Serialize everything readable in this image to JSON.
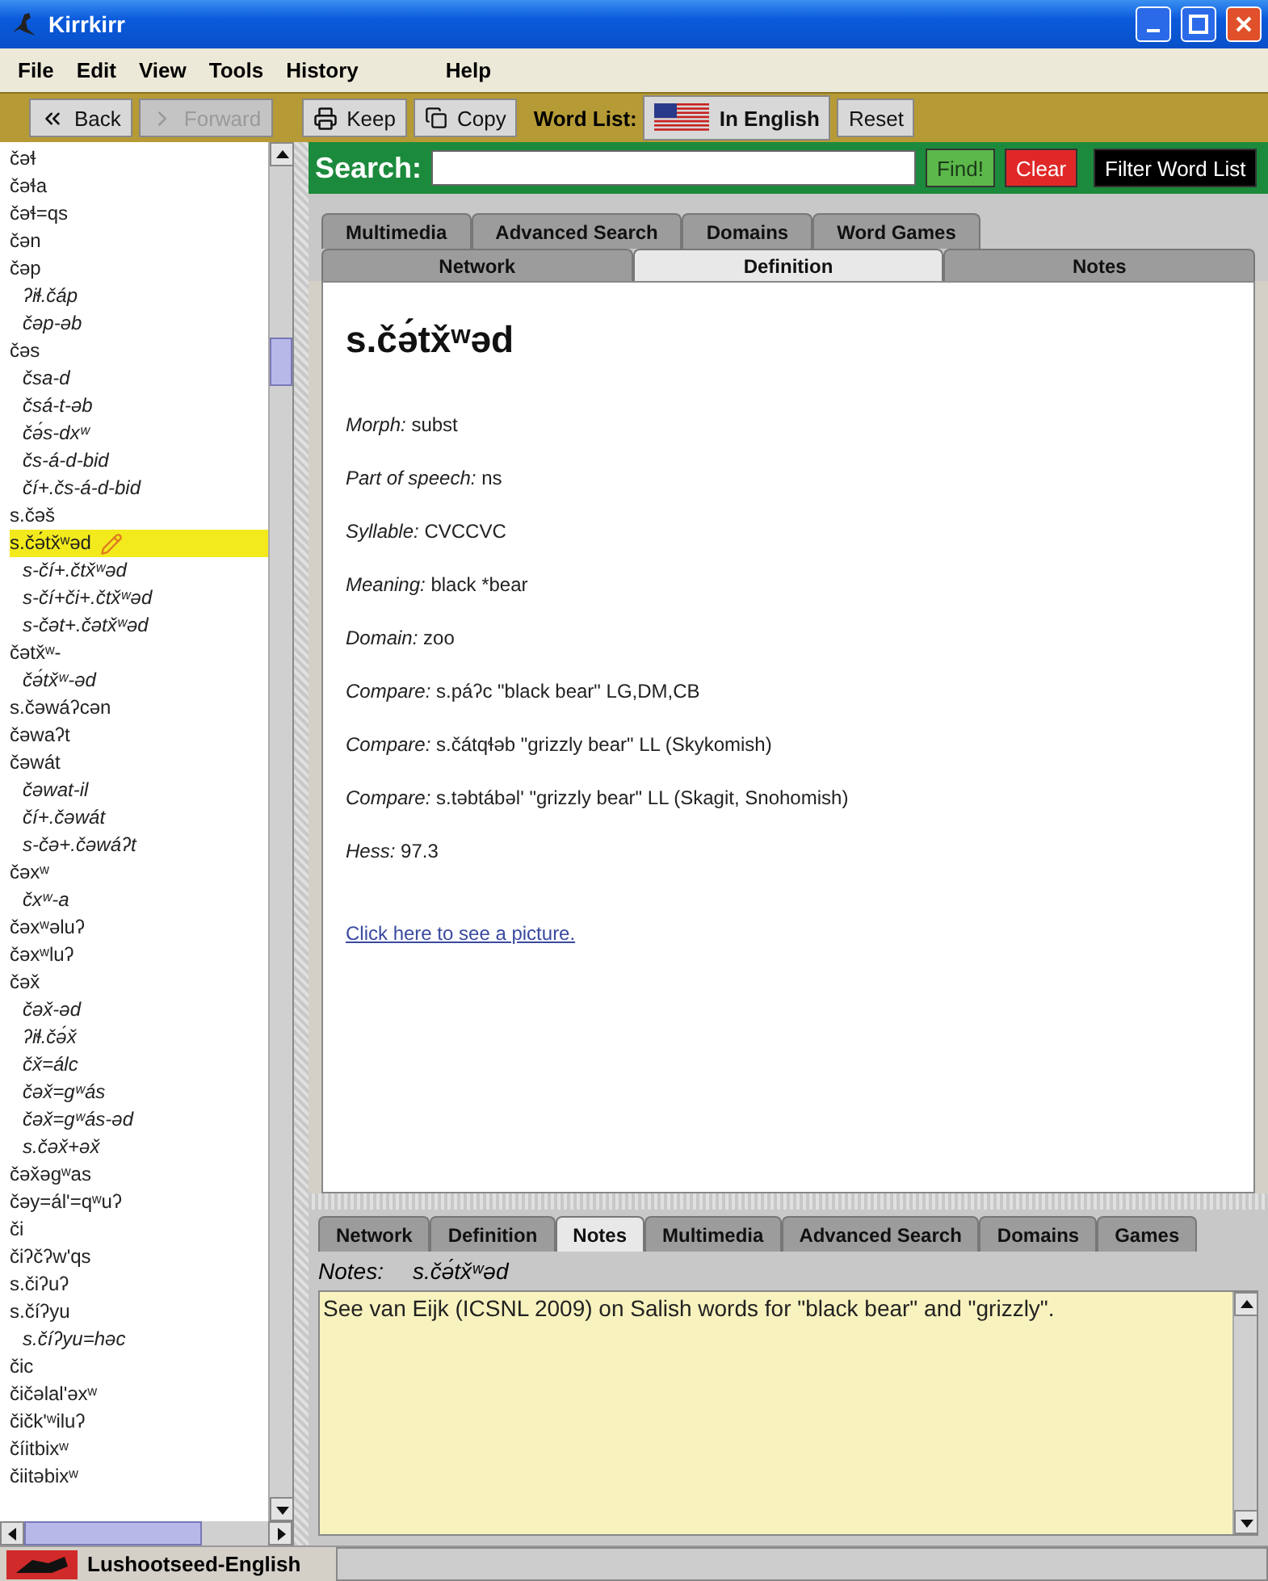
{
  "window": {
    "title": "Kirrkirr"
  },
  "menu": [
    {
      "label": "File"
    },
    {
      "label": "Edit"
    },
    {
      "label": "View"
    },
    {
      "label": "Tools"
    },
    {
      "label": "History"
    },
    {
      "label": "Help"
    }
  ],
  "toolbar": {
    "buttons": [
      {
        "kind": "back",
        "label": "Back",
        "disabled": false
      },
      {
        "kind": "forward",
        "label": "Forward",
        "disabled": true
      },
      {
        "kind": "keep",
        "label": "Keep",
        "disabled": false
      },
      {
        "kind": "copy",
        "label": "Copy",
        "disabled": false
      }
    ],
    "word_list_label": "Word List:",
    "language_button": "In English",
    "reset_button": "Reset"
  },
  "word_list": {
    "items": [
      {
        "text": "čəɬ",
        "selected": false
      },
      {
        "text": "čəɬa",
        "selected": false
      },
      {
        "text": "čəɬ=qs",
        "selected": false
      },
      {
        "text": "čən",
        "selected": false
      },
      {
        "text": "čəp",
        "selected": false,
        "children": [
          {
            "text": "ʔiɬ.čáp",
            "selected": false
          },
          {
            "text": "čəp-əb",
            "selected": false
          }
        ]
      },
      {
        "text": "čəs",
        "selected": false,
        "children": [
          {
            "text": "čsa-d",
            "selected": false
          },
          {
            "text": "čsá-t-əb",
            "selected": false
          },
          {
            "text": "čə́s-dxʷ",
            "selected": false
          },
          {
            "text": "čs-á-d-bid",
            "selected": false
          },
          {
            "text": "čí+.čs-á-d-bid",
            "selected": false
          }
        ]
      },
      {
        "text": "s.čəš",
        "selected": false
      },
      {
        "text": "s.čə́tx̌ʷəd",
        "selected": true,
        "children": [
          {
            "text": "s-čí+.čtx̌ʷəd",
            "selected": false
          },
          {
            "text": "s-čí+či+.čtx̌ʷəd",
            "selected": false
          },
          {
            "text": "s-čət+.čətx̌ʷəd",
            "selected": false
          }
        ]
      },
      {
        "text": "čətx̌ʷ-",
        "selected": false,
        "children": [
          {
            "text": "čə́tx̌ʷ-əd",
            "selected": false
          }
        ]
      },
      {
        "text": "s.čəwáʔcən",
        "selected": false
      },
      {
        "text": "čəwaʔt",
        "selected": false
      },
      {
        "text": "čəwát",
        "selected": false,
        "children": [
          {
            "text": "čəwat-il",
            "selected": false
          },
          {
            "text": "čí+.čəwát",
            "selected": false
          },
          {
            "text": "s-čə+.čəwáʔt",
            "selected": false
          }
        ]
      },
      {
        "text": "čəxʷ",
        "selected": false,
        "children": [
          {
            "text": "čxʷ-a",
            "selected": false
          }
        ]
      },
      {
        "text": "čəxʷəluʔ",
        "selected": false
      },
      {
        "text": "čəxʷluʔ",
        "selected": false
      },
      {
        "text": "čəx̌",
        "selected": false,
        "children": [
          {
            "text": "čəx̌-əd",
            "selected": false
          },
          {
            "text": "ʔiɬ.čə́x̌",
            "selected": false
          },
          {
            "text": "čx̌=álc",
            "selected": false
          },
          {
            "text": "čəx̌=gʷás",
            "selected": false
          },
          {
            "text": "čəx̌=gʷás-əd",
            "selected": false
          },
          {
            "text": "s.čəx̌+əx̌",
            "selected": false
          }
        ]
      },
      {
        "text": "čəx̌əgʷas",
        "selected": false
      },
      {
        "text": "čəy=ál'=qʷuʔ",
        "selected": false
      },
      {
        "text": "či",
        "selected": false
      },
      {
        "text": "čiʔčʔw'qs",
        "selected": false
      },
      {
        "text": "s.čiʔuʔ",
        "selected": false
      },
      {
        "text": "s.číʔyu",
        "selected": false,
        "children": [
          {
            "text": "s.číʔyu=həc",
            "selected": false
          }
        ]
      },
      {
        "text": "čic",
        "selected": false
      },
      {
        "text": "čičəlal'əxʷ",
        "selected": false
      },
      {
        "text": "čičk'ʷiluʔ",
        "selected": false
      },
      {
        "text": "číitbixʷ",
        "selected": false
      },
      {
        "text": "čiitəbixʷ",
        "selected": false
      }
    ]
  },
  "search": {
    "label": "Search:",
    "buttons": [
      {
        "label": "Find!",
        "color": "#5cb84a"
      },
      {
        "label": "Clear",
        "color": "#e02828"
      },
      {
        "label": "Filter Word List",
        "color": "#000000"
      }
    ]
  },
  "top_tabs": {
    "back_row": [
      {
        "label": "Multimedia",
        "selected": false
      },
      {
        "label": "Advanced Search",
        "selected": false
      },
      {
        "label": "Domains",
        "selected": false
      },
      {
        "label": "Word Games",
        "selected": false
      }
    ],
    "front_row": [
      {
        "label": "Network",
        "selected": false
      },
      {
        "label": "Definition",
        "selected": true
      },
      {
        "label": "Notes",
        "selected": false
      }
    ]
  },
  "definition": {
    "headword": "s.čə́tx̌ʷəd",
    "fields": [
      {
        "label": "Morph:",
        "value": "subst"
      },
      {
        "label": "Part of speech:",
        "value": "ns"
      },
      {
        "label": "Syllable:",
        "value": "CVCCVC"
      },
      {
        "label": "Meaning:",
        "value": "black *bear"
      },
      {
        "label": "Domain:",
        "value": "zoo"
      },
      {
        "label": "Compare:",
        "value": "s.páʔc \"black bear\" LG,DM,CB"
      },
      {
        "label": "Compare:",
        "value": "s.čátqɬəb \"grizzly bear\" LL (Skykomish)"
      },
      {
        "label": "Compare:",
        "value": "s.təbtábəl' \"grizzly bear\" LL (Skagit, Snohomish)"
      },
      {
        "label": "Hess:",
        "value": "97.3"
      }
    ],
    "link": "Click here to see a picture."
  },
  "bottom_tabs": [
    {
      "label": "Network",
      "selected": false
    },
    {
      "label": "Definition",
      "selected": false
    },
    {
      "label": "Notes",
      "selected": true
    },
    {
      "label": "Multimedia",
      "selected": false
    },
    {
      "label": "Advanced Search",
      "selected": false
    },
    {
      "label": "Domains",
      "selected": false
    },
    {
      "label": "Games",
      "selected": false
    }
  ],
  "notes": {
    "label": "Notes:",
    "headword": "s.čə́tx̌ʷəd",
    "text": "See van Eijk (ICSNL 2009) on Salish words for \"black bear\" and \"grizzly\"."
  },
  "status_bar": {
    "dictionary": "Lushootseed-English"
  }
}
